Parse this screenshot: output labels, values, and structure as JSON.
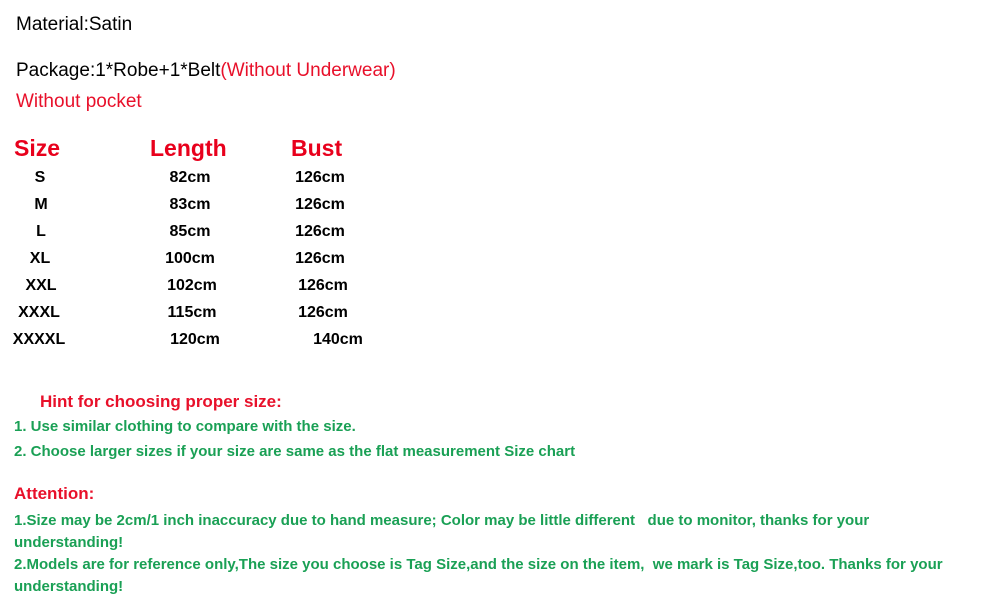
{
  "document": {
    "background_color": "#ffffff",
    "accent_red": "#e8001c",
    "accent_green": "#1aa055",
    "text_black": "#000000"
  },
  "info": {
    "material_line": "Material:Satin",
    "package_label": "Package:1*Robe+1*Belt",
    "package_note": "(Without Underwear)",
    "without_pocket": "Without pocket"
  },
  "size_chart": {
    "headers": {
      "size": "Size",
      "length": "Length",
      "bust": "Bust"
    },
    "rows": [
      {
        "size": "S",
        "length": "82cm",
        "bust": "126cm"
      },
      {
        "size": "M",
        "length": "83cm",
        "bust": "126cm"
      },
      {
        "size": "L",
        "length": "85cm",
        "bust": "126cm"
      },
      {
        "size": "XL",
        "length": "100cm",
        "bust": "126cm"
      },
      {
        "size": "XXL",
        "length": "102cm",
        "bust": "126cm"
      },
      {
        "size": "XXXL",
        "length": "115cm",
        "bust": "126cm"
      },
      {
        "size": "XXXXL",
        "length": "120cm",
        "bust": "140cm"
      }
    ]
  },
  "hint": {
    "title": "Hint for choosing proper size:",
    "items": [
      "1. Use similar clothing to compare with the size.",
      "2. Choose larger sizes if your size are same as the flat measurement Size chart"
    ]
  },
  "attention": {
    "title": "Attention:",
    "items": [
      "1.Size may be 2cm/1 inch inaccuracy due to hand measure; Color may be little different   due to monitor, thanks for your understanding!",
      "2.Models are for reference only,The size you choose is Tag Size,and the size on the item,  we mark is Tag Size,too. Thanks for your understanding!"
    ]
  }
}
